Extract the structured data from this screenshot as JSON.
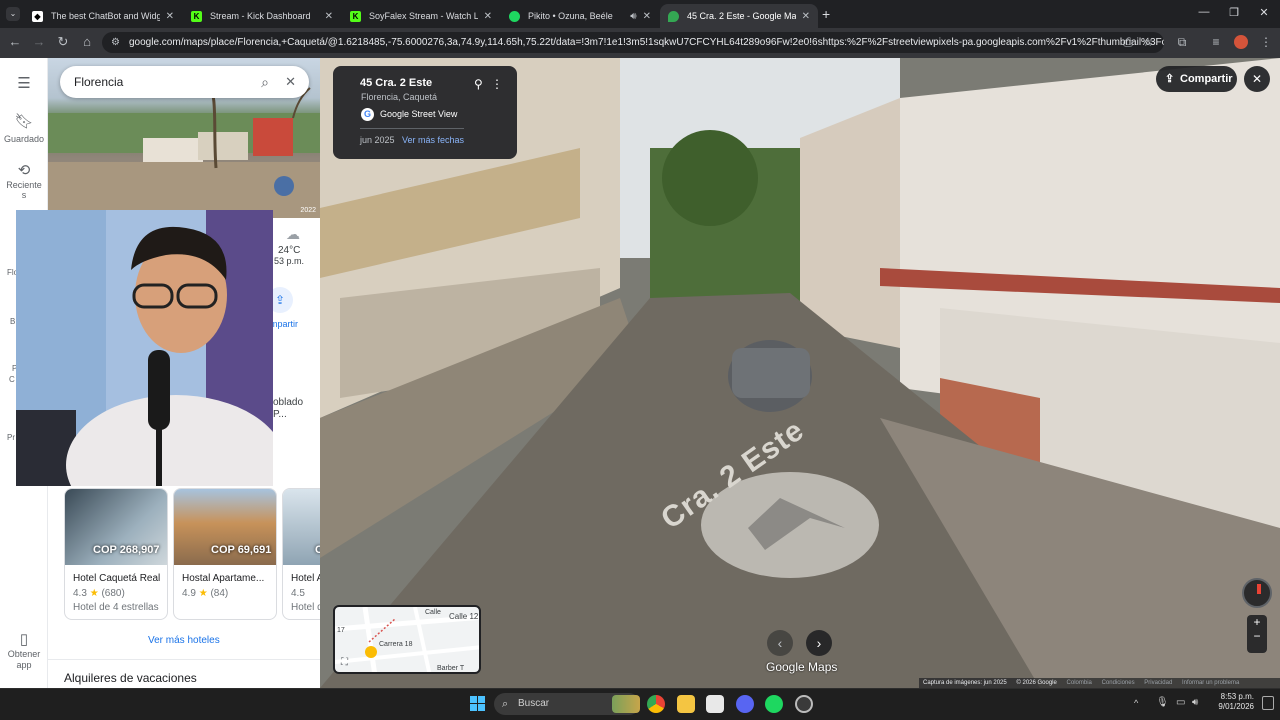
{
  "browser": {
    "tabs": [
      {
        "title": "The best ChatBot and Widgets",
        "color": "#ffffff"
      },
      {
        "title": "Stream - Kick Dashboard",
        "color": "#53fc18"
      },
      {
        "title": "SoyFalex Stream - Watch Live o",
        "color": "#53fc18"
      },
      {
        "title": "Pikito • Ozuna, Beéle",
        "color": "#1ed760"
      },
      {
        "title": "45 Cra. 2 Este - Google Maps",
        "color": "#34a853"
      }
    ],
    "url": "google.com/maps/place/Florencia,+Caquetá/@1.6218485,-75.6000276,3a,74.9y,114.65h,75.22t/data=!3m7!1e1!3m5!1sqkwU7CFCYHL64t289o96Fw!2e0!6shttps:%2F%2Fstreetviewpixels-pa.googleapis.com%2Fv1%2Fthumbnail%3Fcb_client..."
  },
  "rail": {
    "saved": "Guardado",
    "recent_l1": "Reciente",
    "recent_l2": "s",
    "get_app_l1": "Obtener",
    "get_app_l2": "app",
    "frag_fl": "Flo",
    "frag_b": "B",
    "frag_pc": "P",
    "frag_c": "C",
    "frag_pr": "Pr"
  },
  "panel": {
    "search_value": "Florencia",
    "hero_year": "2022",
    "weather_temp": "24°C",
    "weather_time": "53 p.m.",
    "share_label": "mpartir",
    "poblado_l1": "oblado",
    "poblado_l2": "P...",
    "hotels": [
      {
        "price": "COP 268,907",
        "name": "Hotel Caquetá Real",
        "rating": "4.3",
        "reviews": "(680)",
        "type": "Hotel de 4 estrellas"
      },
      {
        "price": "COP 69,691",
        "name": "Hostal Apartame...",
        "rating": "4.9",
        "reviews": "(84)",
        "type": ""
      },
      {
        "price": "C",
        "name": "Hotel A",
        "rating": "4.5",
        "reviews": "",
        "type": "Hotel d"
      }
    ],
    "more_hotels": "Ver más hoteles",
    "vacation_rentals": "Alquileres de vacaciones"
  },
  "streetview": {
    "address": "45 Cra. 2 Este",
    "city": "Florencia, Caquetá",
    "brand": "Google Street View",
    "date": "jun 2025",
    "more_dates": "Ver más fechas",
    "share": "Compartir",
    "street_paint": "Cra. 2 Este",
    "minimap_label1": "Calle 12",
    "minimap_label2": "Carrera 18",
    "minimap_label3": "Calle",
    "minimap_label4": "Barber T",
    "minimap_label5": "17",
    "watermark": "Google Maps",
    "footer": [
      "Captura de imágenes: jun 2025",
      "© 2026 Google",
      "Colombia",
      "Condiciones",
      "Privacidad",
      "Informar un problema"
    ]
  },
  "taskbar": {
    "search": "Buscar",
    "time": "8:53 p.m.",
    "date": "9/01/2026"
  }
}
